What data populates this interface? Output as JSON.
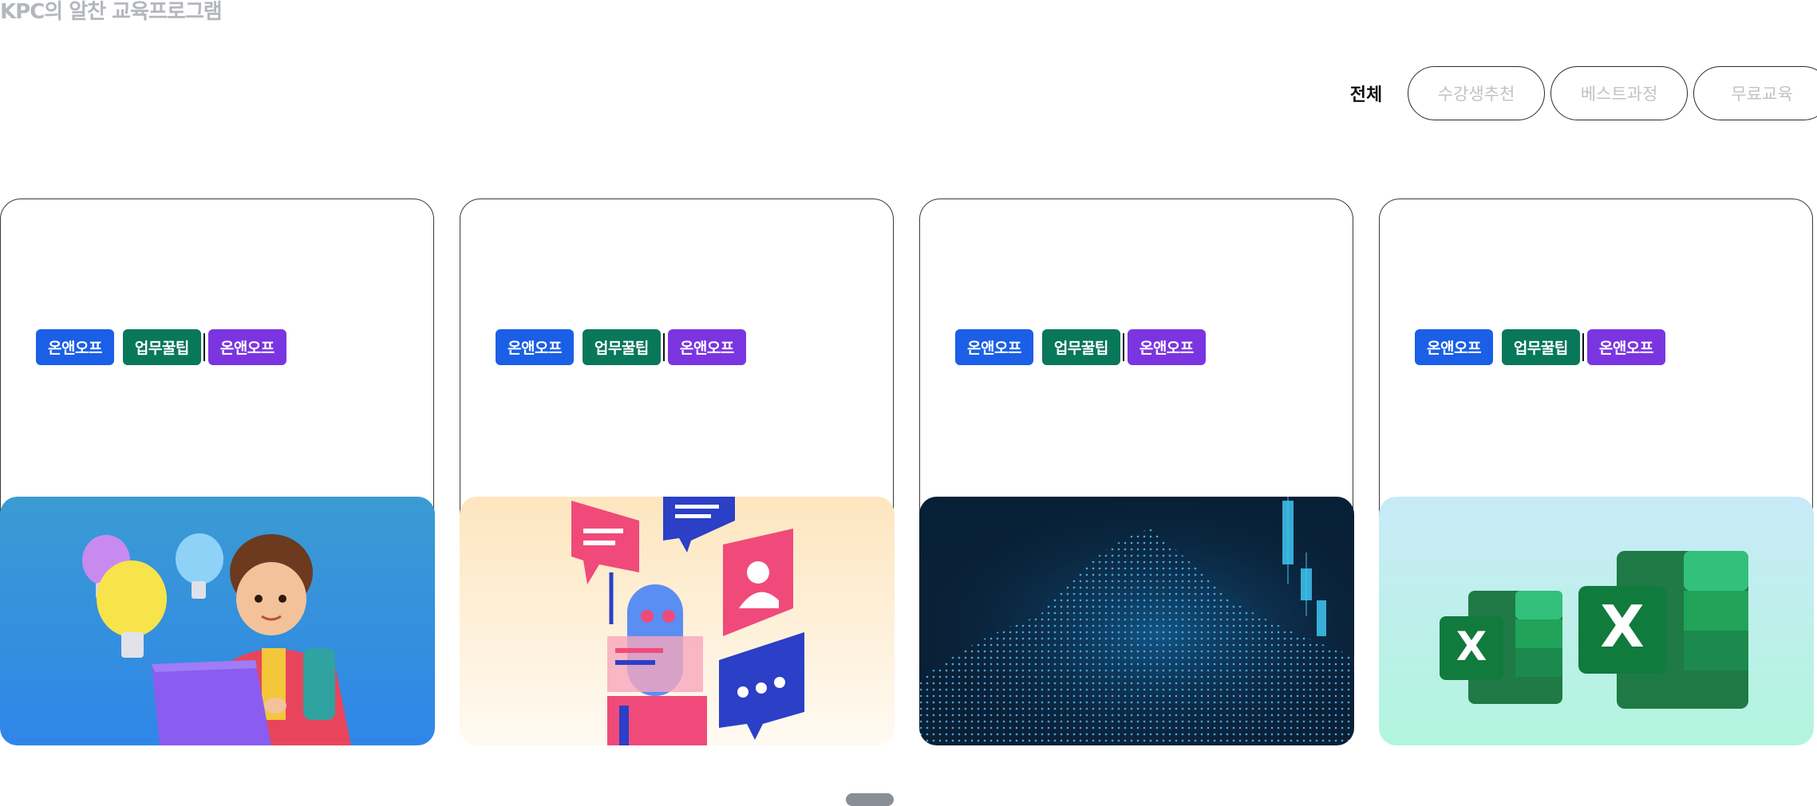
{
  "section_title": "KPC의 알찬 교육프로그램",
  "filters": {
    "active": "전체",
    "pills": [
      "수강생추천",
      "베스트과정",
      "무료교육"
    ]
  },
  "cards": [
    {
      "tags": [
        "온앤오프",
        "업무꿀팁",
        "온앤오프"
      ],
      "image": "student-laptop-lightbulbs-illustration"
    },
    {
      "tags": [
        "온앤오프",
        "업무꿀팁",
        "온앤오프"
      ],
      "image": "chatbot-robot-speech-bubbles-illustration"
    },
    {
      "tags": [
        "온앤오프",
        "업무꿀팁",
        "온앤오프"
      ],
      "image": "digital-data-particles-illustration"
    },
    {
      "tags": [
        "온앤오프",
        "업무꿀팁",
        "온앤오프"
      ],
      "image": "excel-logo-illustration"
    }
  ],
  "colors": {
    "tag_blue": "#1a5fe6",
    "tag_green": "#08775a",
    "tag_purple": "#7b35e0",
    "pager": "#8a8e96"
  }
}
